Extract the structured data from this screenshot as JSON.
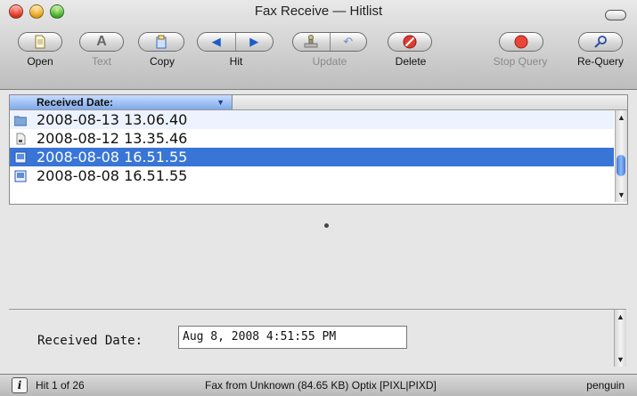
{
  "window": {
    "title": "Fax Receive — Hitlist"
  },
  "toolbar": {
    "open": "Open",
    "text": "Text",
    "copy": "Copy",
    "hit": "Hit",
    "update": "Update",
    "delete": "Delete",
    "stop_query": "Stop Query",
    "requery": "Re-Query"
  },
  "list": {
    "column_header": "Received Date:",
    "rows": [
      {
        "date": "2008-08-13 13.06.40",
        "icon": "folder-icon"
      },
      {
        "date": "2008-08-12 13.35.46",
        "icon": "document-icon"
      },
      {
        "date": "2008-08-08 16.51.55",
        "icon": "fax-image-icon",
        "selected": true
      },
      {
        "date": "2008-08-08 16.51.55",
        "icon": "fax-image-icon"
      }
    ]
  },
  "detail": {
    "label": "Received Date:",
    "value": "Aug 8, 2008 4:51:55 PM"
  },
  "status": {
    "hit": "Hit 1 of 26",
    "message": "Fax from Unknown (84.65 KB) Optix [PIXL|PIXD]",
    "user": "penguin"
  },
  "colors": {
    "selection": "#3875d7",
    "alt_row": "#edf3fe"
  }
}
